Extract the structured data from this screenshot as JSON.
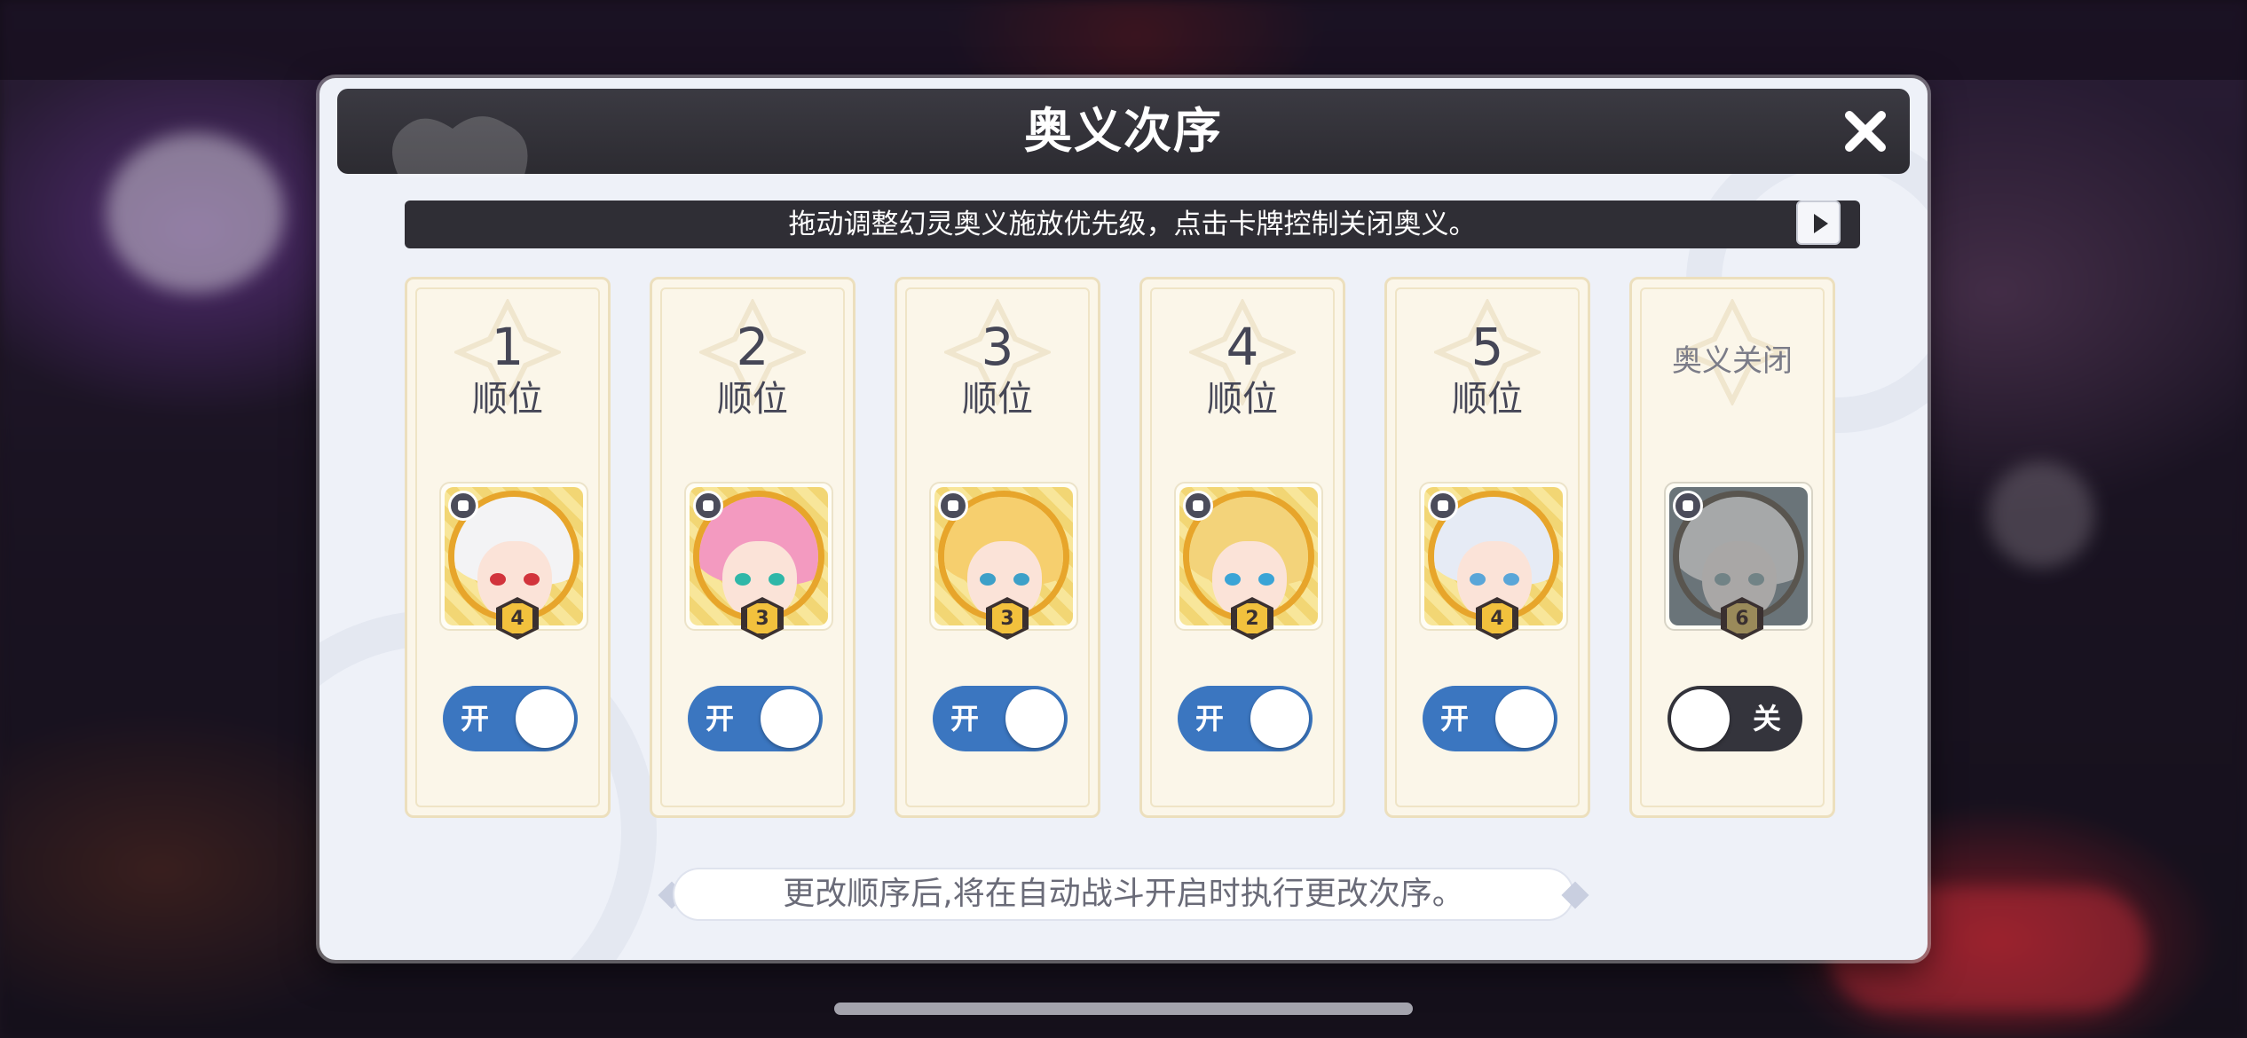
{
  "dialog": {
    "title": "奥义次序",
    "hint": "拖动调整幻灵奥义施放优先级，点击卡牌控制关闭奥义。",
    "footer_note": "更改顺序后,将在自动战斗开启时执行更改次序。"
  },
  "cards": [
    {
      "order": "1",
      "order_label": "顺位",
      "level": "4",
      "role_icon": "book-icon",
      "toggle_label": "开",
      "state": "on",
      "hair_color": "#f3f3f5",
      "eye_color": "#d2343c"
    },
    {
      "order": "2",
      "order_label": "顺位",
      "level": "3",
      "role_icon": "bird-icon",
      "toggle_label": "开",
      "state": "on",
      "hair_color": "#f39ac0",
      "eye_color": "#2fb7a8"
    },
    {
      "order": "3",
      "order_label": "顺位",
      "level": "3",
      "role_icon": "hammer-icon",
      "toggle_label": "开",
      "state": "on",
      "hair_color": "#f6cf6e",
      "eye_color": "#3da0c8"
    },
    {
      "order": "4",
      "order_label": "顺位",
      "level": "2",
      "role_icon": "shield-icon",
      "toggle_label": "开",
      "state": "on",
      "hair_color": "#f3d37a",
      "eye_color": "#3aa4d6"
    },
    {
      "order": "5",
      "order_label": "顺位",
      "level": "4",
      "role_icon": "spade-icon",
      "toggle_label": "开",
      "state": "on",
      "hair_color": "#e6ebf5",
      "eye_color": "#5aa6d8"
    },
    {
      "off_label": "奥义关闭",
      "level": "6",
      "role_icon": "book-icon",
      "toggle_label": "关",
      "state": "off",
      "hair_color": "#c8d4d8",
      "eye_color": "#5ab0c0"
    }
  ],
  "colors": {
    "toggle_on": "#3b76c0",
    "toggle_off": "#34343c",
    "title_bar": "#2c2b31",
    "card_bg": "#fbf6e9"
  }
}
